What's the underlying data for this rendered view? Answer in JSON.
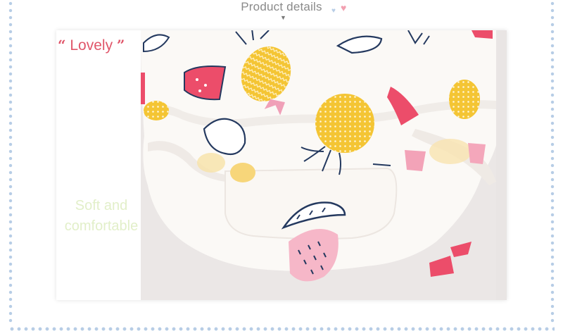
{
  "header": {
    "title": "Product details",
    "arrow": "▼",
    "hearts": [
      "♥",
      "♥"
    ]
  },
  "panel": {
    "tag": {
      "open_quote": "“",
      "label": "Lovely",
      "close_quote": "”"
    },
    "feature_line1": "Soft and",
    "feature_line2": "comfortable"
  },
  "colors": {
    "tag": "#e0566a",
    "feature_text": "#e2efc9",
    "border_dots": "#b7cde6",
    "accent_heart": "#f2a0b0",
    "pineapple": "#f4c534",
    "watermelon": "#ec4d6a",
    "outline": "#24395f"
  }
}
